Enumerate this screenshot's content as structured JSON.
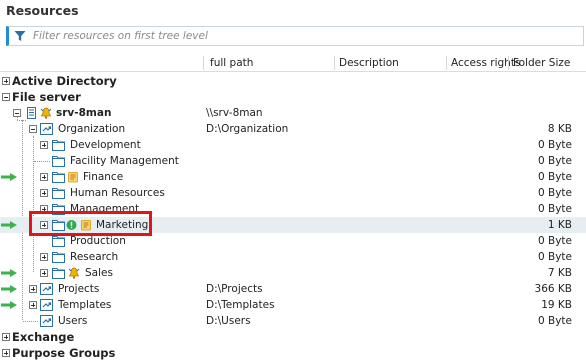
{
  "page": {
    "title": "Resources"
  },
  "filter": {
    "placeholder": "Filter resources on first tree level"
  },
  "columns": {
    "path": "full path",
    "description": "Description",
    "access": "Access rights",
    "size": "Folder Size"
  },
  "tree": {
    "active_directory": "Active Directory",
    "file_server": "File server",
    "server": {
      "name": "srv-8man",
      "path": "\\\\srv-8man"
    },
    "organization": {
      "name": "Organization",
      "path": "D:\\Organization",
      "size": "8 KB"
    },
    "development": {
      "name": "Development",
      "size": "0 Byte"
    },
    "facility": {
      "name": "Facility Management",
      "size": "0 Byte"
    },
    "finance": {
      "name": "Finance",
      "size": "0 Byte"
    },
    "hr": {
      "name": "Human Resources",
      "size": "0 Byte"
    },
    "management": {
      "name": "Management",
      "size": "0 Byte"
    },
    "marketing": {
      "name": "Marketing",
      "size": "1 KB"
    },
    "production": {
      "name": "Production",
      "size": "0 Byte"
    },
    "research": {
      "name": "Research",
      "size": "0 Byte"
    },
    "sales": {
      "name": "Sales",
      "size": "7 KB"
    },
    "projects": {
      "name": "Projects",
      "path": "D:\\Projects",
      "size": "366 KB"
    },
    "templates": {
      "name": "Templates",
      "path": "D:\\Templates",
      "size": "19 KB"
    },
    "users": {
      "name": "Users",
      "path": "D:\\Users",
      "size": "0 Byte"
    },
    "exchange": "Exchange",
    "purpose_groups": "Purpose Groups"
  },
  "colors": {
    "accent": "#1e8fd6",
    "folder": "#2a6fa8",
    "arrow": "#3bb34a",
    "highlight": "#e0151b",
    "selected_row": "#e6eef2"
  },
  "icons": {
    "filter": "funnel-icon",
    "server": "server-icon",
    "share": "share-icon",
    "folder": "folder-icon",
    "notice": "bell-icon",
    "warning": "warning-icon",
    "marker": "green-arrow-icon"
  }
}
